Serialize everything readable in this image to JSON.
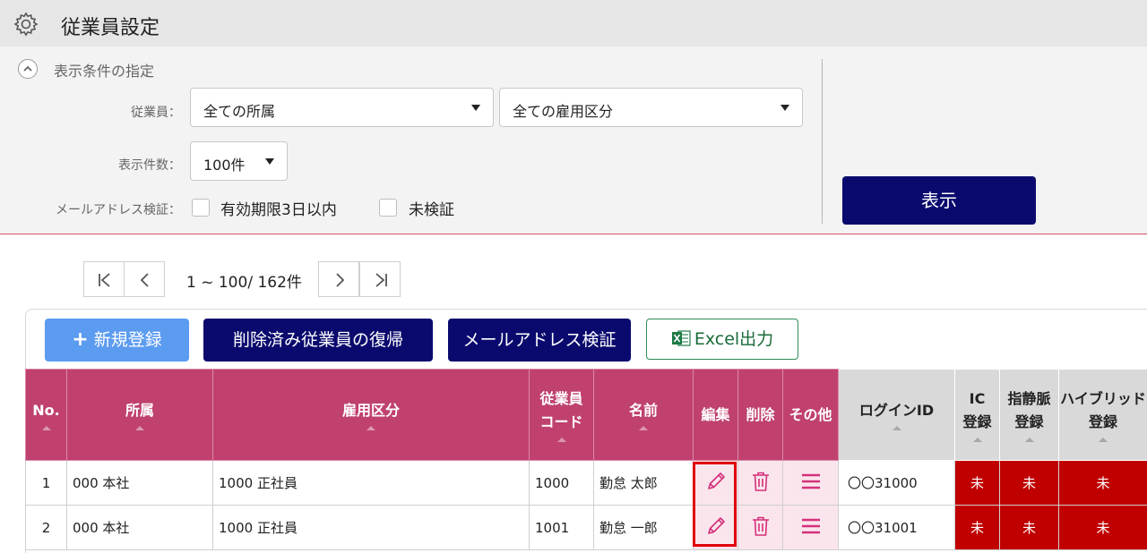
{
  "header": {
    "title": "従業員設定",
    "icon": "gear-icon"
  },
  "filter": {
    "section_title": "表示条件の指定",
    "employee_label": "従業員：",
    "affiliation_select": "全ての所属",
    "employment_select": "全ての雇用区分",
    "count_label": "表示件数：",
    "count_select": "100件",
    "email_label": "メールアドレス検証：",
    "checkbox_expiry": "有効期限3日以内",
    "checkbox_unverified": "未検証",
    "show_button": "表示"
  },
  "pager": {
    "range_text": "1 ~ 100/ 162件"
  },
  "actions": {
    "new_label": "新規登録",
    "restore_label": "削除済み従業員の復帰",
    "verify_label": "メールアドレス検証",
    "excel_label": "Excel出力"
  },
  "table": {
    "columns": {
      "no": "No.",
      "affiliation": "所属",
      "employment": "雇用区分",
      "code_line1": "従業員",
      "code_line2": "コード",
      "name": "名前",
      "edit": "編集",
      "delete": "削除",
      "other": "その他",
      "login": "ログインID",
      "ic_line1": "IC",
      "ic_line2": "登録",
      "vein_line1": "指静脈",
      "vein_line2": "登録",
      "hybrid_line1": "ハイブリッド",
      "hybrid_line2": "登録"
    },
    "rows": [
      {
        "no": "1",
        "affiliation": "000 本社",
        "employment": "1000 正社員",
        "code": "1000",
        "name": "勤怠 太郎",
        "login": "〇〇31000",
        "ic": "未",
        "vein": "未",
        "hybrid": "未"
      },
      {
        "no": "2",
        "affiliation": "000 本社",
        "employment": "1000 正社員",
        "code": "1001",
        "name": "勤怠 一郎",
        "login": "〇〇31001",
        "ic": "未",
        "vein": "未",
        "hybrid": "未"
      }
    ]
  },
  "colors": {
    "header_pink": "#c0416f",
    "navy_button": "#0a0a6e",
    "blue_button": "#5b9bf0",
    "unregistered_red": "#c00000",
    "action_icon_pink": "#d4307a",
    "highlight_red": "#e0000b"
  }
}
